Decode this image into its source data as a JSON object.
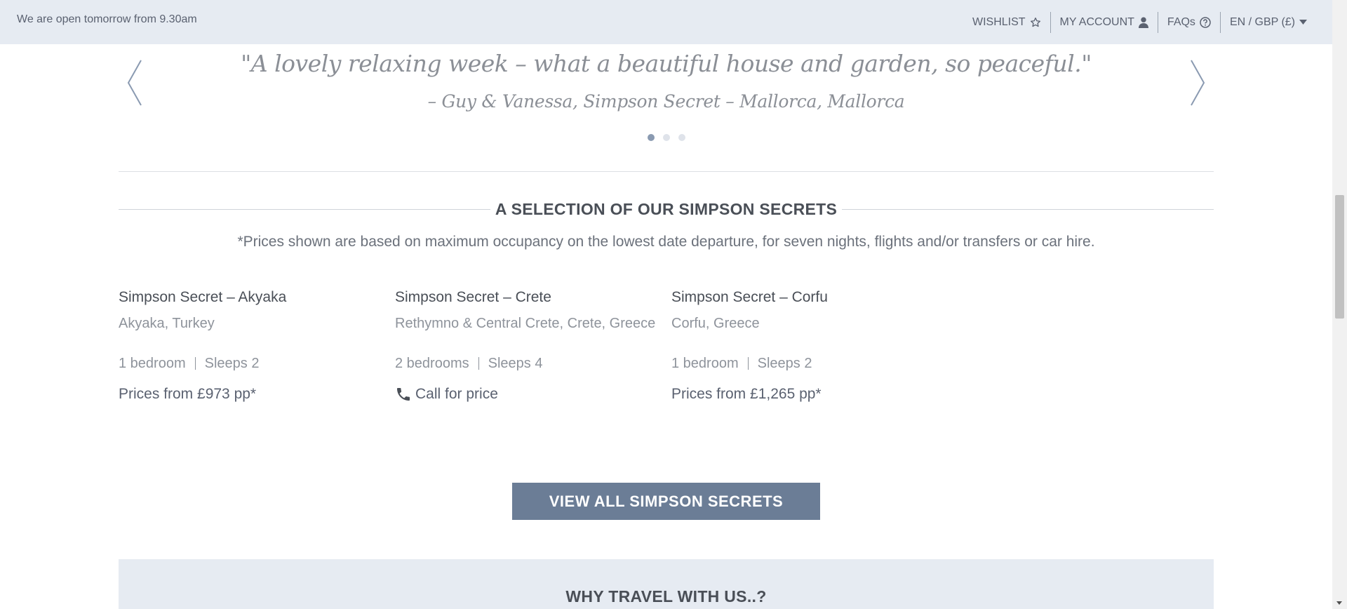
{
  "topbar": {
    "open_message": "We are open tomorrow from 9.30am",
    "nav": {
      "wishlist": "WISHLIST",
      "my_account": "MY ACCOUNT",
      "faqs": "FAQs",
      "locale": "EN / GBP (£)"
    }
  },
  "testimonial": {
    "quote": "\"A lovely relaxing week – what a beautiful house and garden, so peaceful.\"",
    "author": "– Guy & Vanessa, Simpson Secret – Mallorca, Mallorca",
    "active_slide": 1,
    "slide_count": 3
  },
  "section": {
    "title": "A SELECTION OF OUR SIMPSON SECRETS",
    "price_note": "*Prices shown are based on maximum occupancy on the lowest date departure, for seven nights, flights and/or transfers or car hire."
  },
  "properties": [
    {
      "title": "Simpson Secret – Akyaka",
      "location": "Akyaka, Turkey",
      "bedrooms": "1 bedroom",
      "sleeps": "Sleeps 2",
      "price": "Prices from £973 pp*"
    },
    {
      "title": "Simpson Secret – Crete",
      "location": "Rethymno & Central Crete, Crete, Greece",
      "bedrooms": "2 bedrooms",
      "sleeps": "Sleeps 4",
      "price": "Call for price"
    },
    {
      "title": "Simpson Secret – Corfu",
      "location": "Corfu, Greece",
      "bedrooms": "1 bedroom",
      "sleeps": "Sleeps 2",
      "price": "Prices from £1,265 pp*"
    }
  ],
  "cta": {
    "label": "VIEW ALL SIMPSON SECRETS"
  },
  "why": {
    "title": "WHY TRAVEL WITH US..?"
  },
  "colors": {
    "topbar_bg": "#e6ebf2",
    "cta_bg": "#6b7d96",
    "dot_active": "#8a9ab1"
  },
  "icons": [
    "star-icon",
    "user-icon",
    "help-circle-icon",
    "caret-down-icon",
    "chevron-left-icon",
    "chevron-right-icon",
    "phone-icon"
  ]
}
